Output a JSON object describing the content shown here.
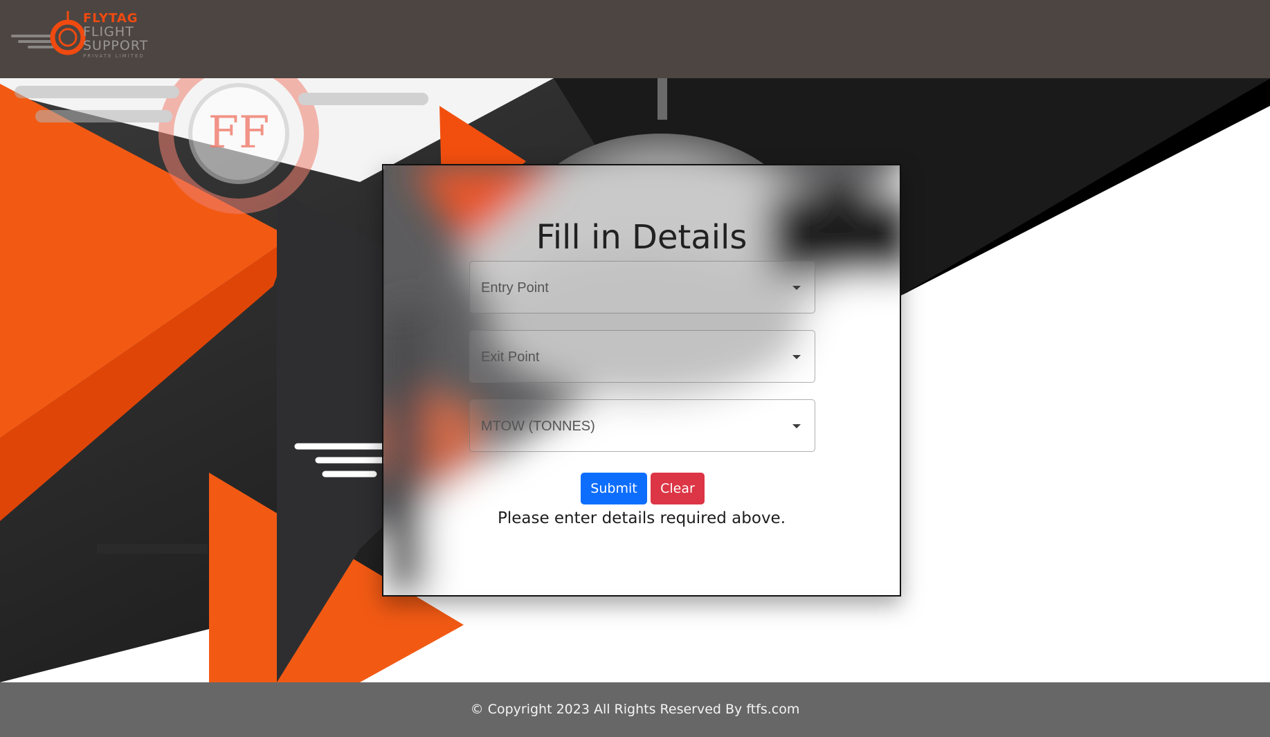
{
  "header": {
    "logo": {
      "line1": "FLYTAG",
      "line2": "FLIGHT",
      "line3": "SUPPORT",
      "line4": "PRIVATE LIMITED",
      "mark": "FF"
    }
  },
  "hero": {
    "emblem_letters": "FF"
  },
  "form": {
    "title": "Fill in Details",
    "fields": [
      {
        "selected": "Entry Point"
      },
      {
        "selected": "Exit Point"
      },
      {
        "selected": "MTOW (TONNES)"
      }
    ],
    "submit_label": "Submit",
    "clear_label": "Clear",
    "message": "Please enter details required above."
  },
  "footer": {
    "copyright": "© Copyright 2023 All Rights Reserved By ftfs.com"
  },
  "colors": {
    "header_bg": "#4c4541",
    "brand_orange": "#f04a10",
    "submit_blue": "#0d6efd",
    "clear_red": "#dc3545",
    "footer_bg": "#676767"
  }
}
